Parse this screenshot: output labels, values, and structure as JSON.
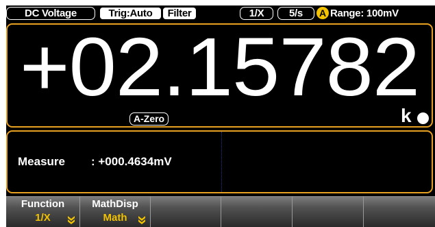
{
  "status": {
    "function": "DC Voltage",
    "trigger": "Trig:Auto",
    "filter": "Filter",
    "math": "1/X",
    "rate": "5/s",
    "auto_badge": "A",
    "range": "Range: 100mV"
  },
  "display": {
    "reading": "+02.15782",
    "auto_zero": "A-Zero",
    "unit": "k"
  },
  "secondary": {
    "label": "Measure",
    "value": ": +000.4634mV"
  },
  "softkeys": [
    {
      "title": "Function",
      "value": "1/X"
    },
    {
      "title": "MathDisp",
      "value": "Math"
    },
    {
      "title": "",
      "value": ""
    },
    {
      "title": "",
      "value": ""
    },
    {
      "title": "",
      "value": ""
    },
    {
      "title": "",
      "value": ""
    }
  ],
  "colors": {
    "accent": "#f2c200",
    "panel_border": "#e8a020",
    "background": "#000000"
  },
  "icons": {
    "auto_range": "a-circle-icon",
    "softkey_arrow": "double-chevron-down-icon",
    "status_dot": "indicator-dot-icon"
  }
}
